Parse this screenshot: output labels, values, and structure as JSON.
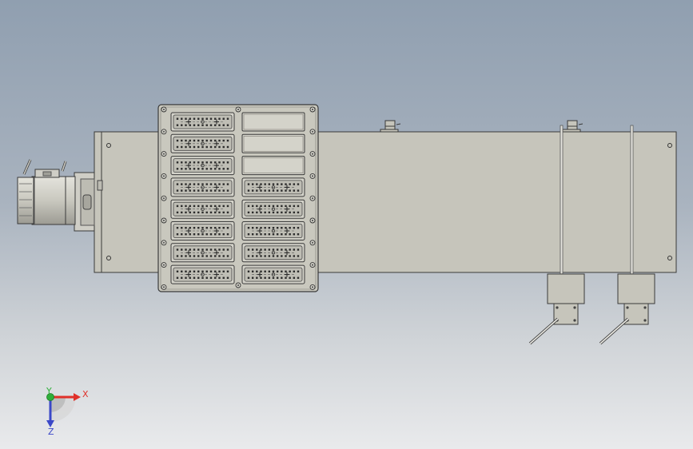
{
  "viewport": {
    "name": "cad-graphics-area",
    "background_top": "#909fb0",
    "background_bottom": "#e9eaec"
  },
  "model": {
    "body_color": "#c6c5bb",
    "outline_color": "#3a3a3a",
    "panel": {
      "connector_rows": 8,
      "left_column": "connector",
      "right_column_blank_slots": 3,
      "right_column_connectors": 5
    }
  },
  "triad": {
    "x_label": "X",
    "y_label": "Y",
    "z_label": "Z",
    "x_color": "#e0302a",
    "y_color": "#2fae3a",
    "z_color": "#3b48c8"
  }
}
